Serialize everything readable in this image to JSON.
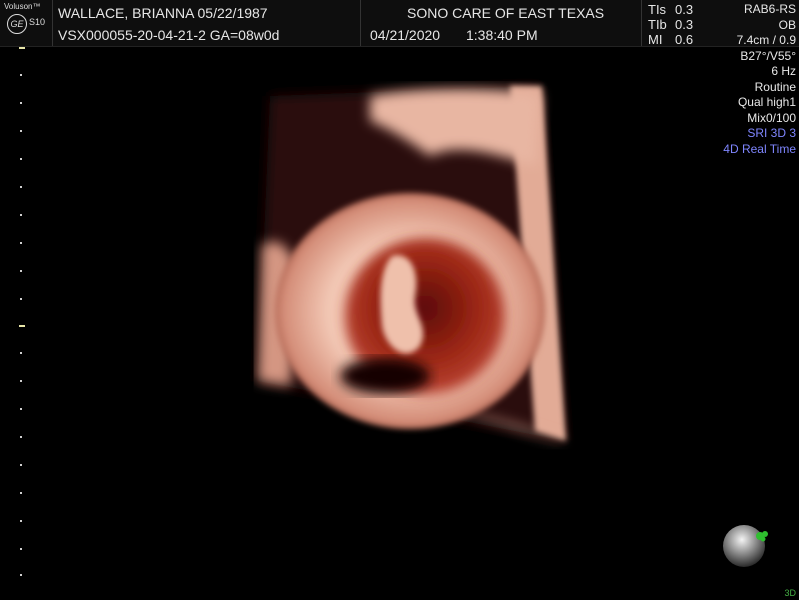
{
  "header": {
    "brand": "Voluson™",
    "model": "S10",
    "logo_text": "GE",
    "patient": "WALLACE, BRIANNA  05/22/1987",
    "exam_id": "VSX000055-20-04-21-2  GA=08w0d",
    "institution": "SONO CARE OF EAST TEXAS",
    "date": "04/21/2020",
    "time": "1:38:40 PM",
    "indices": [
      {
        "label": "TIs",
        "value": "0.3"
      },
      {
        "label": "TIb",
        "value": "0.3"
      },
      {
        "label": "MI",
        "value": "0.6"
      }
    ]
  },
  "params": {
    "probe": "RAB6-RS",
    "app": "OB",
    "depth": "7.4cm / 0.9",
    "angle": "B27°/V55°",
    "rate": "6 Hz",
    "preset": "Routine",
    "quality": "Qual high1",
    "mix": "Mix0/100",
    "sri": "SRI 3D 3",
    "mode": "4D Real Time"
  },
  "footer": {
    "mode_label": "3D"
  },
  "icons": {
    "logo": "ge-logo-icon",
    "orientation": "orientation-sphere-icon"
  },
  "colors": {
    "accent_blue": "#7f86ff",
    "accent_green": "#45b045",
    "background": "#000000",
    "tissue": "#e8b3a0"
  }
}
